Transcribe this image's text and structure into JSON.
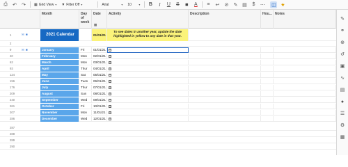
{
  "toolbar": {
    "view_label": "Grid View",
    "filter_label": "Filter Off",
    "font_family": "Arial",
    "font_size": "10",
    "bold": "B",
    "italic": "I",
    "underline": "U",
    "strike": "S",
    "text_color": "A"
  },
  "columns": {
    "month": "Month",
    "day_of_week": "Day of week",
    "date": "Date",
    "activity": "Activity",
    "description": "Description",
    "hours": "Hou...",
    "notes": "Notes"
  },
  "title_row": {
    "row_number": "1",
    "title": "2021 Calendar",
    "date": "01/01/21",
    "note": "To see dates in another year, update the date highlighted in yellow to any date in that year."
  },
  "blank_rows": [
    "2",
    "287",
    "288",
    "289",
    "290"
  ],
  "months": [
    {
      "num": "9",
      "month": "January",
      "day": "Fri",
      "date": "01/01/21"
    },
    {
      "num": "40",
      "month": "February",
      "day": "Mon",
      "date": "02/01/21"
    },
    {
      "num": "62",
      "month": "March",
      "day": "Mon",
      "date": "03/01/21"
    },
    {
      "num": "93",
      "month": "April",
      "day": "Thur",
      "date": "04/01/21"
    },
    {
      "num": "124",
      "month": "May",
      "day": "Sat",
      "date": "05/01/21"
    },
    {
      "num": "156",
      "month": "June",
      "day": "Tues",
      "date": "06/01/21"
    },
    {
      "num": "176",
      "month": "July",
      "day": "Thur",
      "date": "07/01/21"
    },
    {
      "num": "209",
      "month": "August",
      "day": "Sun",
      "date": "08/01/21"
    },
    {
      "num": "240",
      "month": "September",
      "day": "Wed",
      "date": "09/01/21"
    },
    {
      "num": "261",
      "month": "October",
      "day": "Fri",
      "date": "10/01/21"
    },
    {
      "num": "207",
      "month": "November",
      "day": "Mon",
      "date": "11/01/21"
    },
    {
      "num": "286",
      "month": "December",
      "day": "Wed",
      "date": "12/01/21"
    }
  ],
  "colors": {
    "title_bg": "#1769c3",
    "month_bg": "#5aa6ea",
    "highlight": "#fbf37a",
    "accent": "#2b6cc4"
  }
}
